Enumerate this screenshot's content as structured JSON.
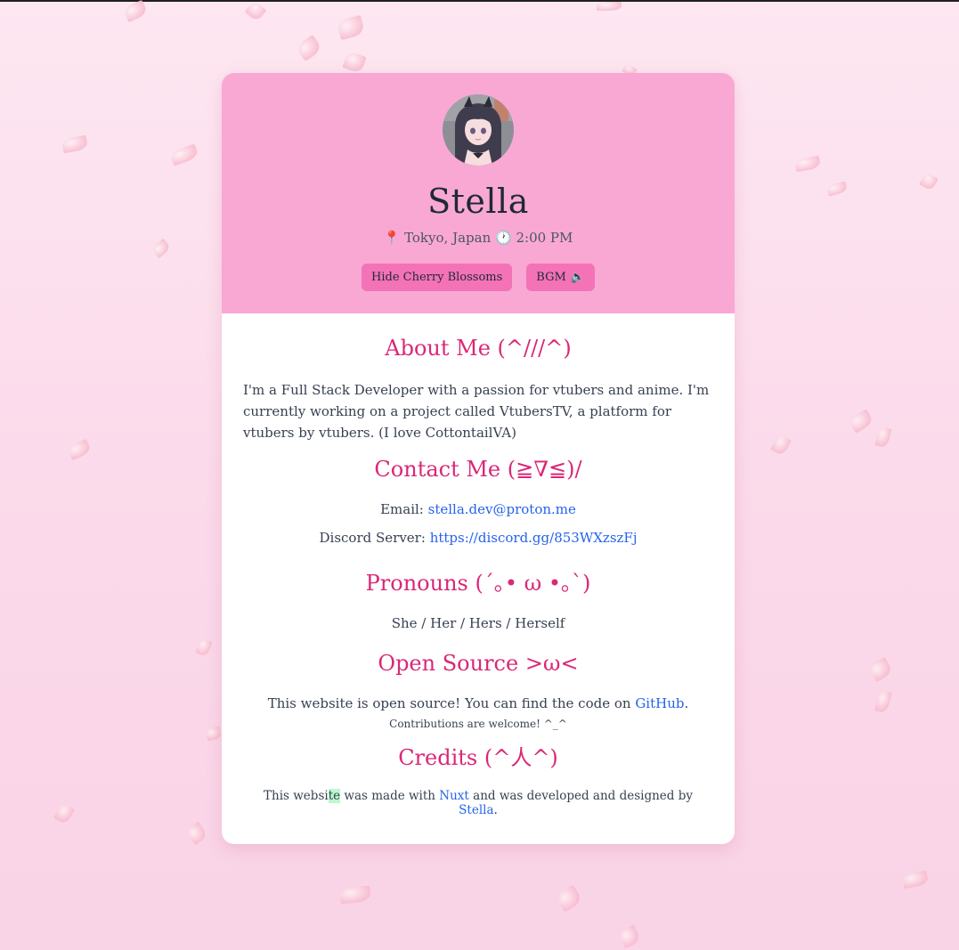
{
  "profile": {
    "name": "Stella",
    "location": "Tokyo, Japan",
    "time": "2:00 PM",
    "location_icon": "pin-icon",
    "time_icon": "clock-icon"
  },
  "buttons": {
    "cherry": "Hide Cherry Blossoms",
    "bgm": "BGM",
    "bgm_icon": "speaker-icon"
  },
  "about": {
    "title": "About Me (^///^)",
    "text": "I'm a Full Stack Developer with a passion for vtubers and anime. I'm currently working on a project called VtubersTV, a platform for vtubers by vtubers.  (I love CottontailVA)"
  },
  "contact": {
    "title": "Contact Me (≧∇≦)/",
    "email_label": "Email:",
    "email_value": "stella.dev@proton.me",
    "discord_label": "Discord Server:",
    "discord_value": "https://discord.gg/853WXzszFj"
  },
  "pronouns": {
    "title": "Pronouns (´｡• ω •｡`)",
    "text": "She / Her / Hers / Herself"
  },
  "opensource": {
    "title": "Open Source >ω<",
    "text_before": "This website is open source! You can find the code on",
    "link": "GitHub",
    "text_after": ".",
    "note": "Contributions are welcome! ^_^"
  },
  "credits": {
    "title": "Credits (^人^)",
    "part1": "This websi",
    "part1_highlight": "te",
    "part2": " was made with",
    "nuxt": "Nuxt",
    "part3": "and was developed and designed by",
    "author": "Stella",
    "end": "."
  },
  "colors": {
    "accent": "#db2777",
    "header_bg": "#f9a8d4",
    "button_bg": "#f472b6",
    "link": "#2563eb"
  }
}
